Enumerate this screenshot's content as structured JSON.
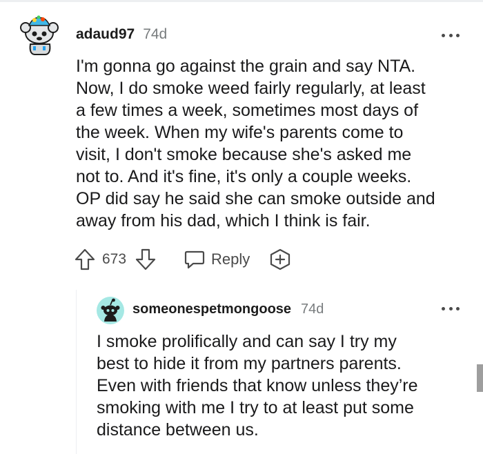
{
  "comments": [
    {
      "username": "adaud97",
      "age": "74d",
      "body": "I'm gonna go against the grain and say NTA.\nNow, I do smoke weed fairly regularly, at least\na few times a week, sometimes most days of\nthe week. When my wife's parents come to\nvisit, I don't smoke because she's asked me\nnot to. And it's fine, it's only a couple weeks.\nOP did say he said she can smoke outside and\naway from his dad, which I think is fair.",
      "score": "673",
      "reply_label": "Reply",
      "avatar_icon": "snoo-avatar-icon",
      "more_icon": "more-options-icon"
    },
    {
      "username": "someonespetmongoose",
      "age": "74d",
      "body": "I smoke prolifically and can say I try my\nbest to hide it from my partners parents.\nEven with friends that know unless they’re\nsmoking with me I try to at least put some\ndistance between us.",
      "avatar_icon": "default-snoo-avatar-icon",
      "more_icon": "more-options-icon"
    }
  ],
  "colors": {
    "text": "#1a1a1b",
    "meta": "#787c7e",
    "icon": "#4a4a4a",
    "avatar2_bg": "#a5e8e4",
    "thread_line": "#edeff1"
  }
}
